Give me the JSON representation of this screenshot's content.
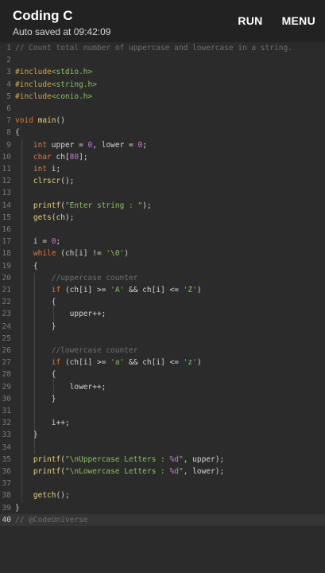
{
  "app": {
    "title": "Coding C",
    "autosave_text": "Auto saved at 09:42:09",
    "run_label": "RUN",
    "menu_label": "MENU"
  },
  "editor": {
    "active_line": 40,
    "lines": [
      {
        "n": "1",
        "tokens": [
          {
            "t": "c",
            "v": "// Count total number of uppercase and lowercase in a string."
          }
        ]
      },
      {
        "n": "2",
        "tokens": []
      },
      {
        "n": "3",
        "tokens": [
          {
            "t": "p",
            "v": "#include"
          },
          {
            "t": "h",
            "v": "<stdio.h>"
          }
        ]
      },
      {
        "n": "4",
        "tokens": [
          {
            "t": "p",
            "v": "#include"
          },
          {
            "t": "h",
            "v": "<string.h>"
          }
        ]
      },
      {
        "n": "5",
        "tokens": [
          {
            "t": "p",
            "v": "#include"
          },
          {
            "t": "h",
            "v": "<conio.h>"
          }
        ]
      },
      {
        "n": "6",
        "tokens": []
      },
      {
        "n": "7",
        "tokens": [
          {
            "t": "k",
            "v": "void"
          },
          {
            "t": "d",
            "v": " "
          },
          {
            "t": "f",
            "v": "main"
          },
          {
            "t": "d",
            "v": "()"
          }
        ]
      },
      {
        "n": "8",
        "tokens": [
          {
            "t": "d",
            "v": "{"
          }
        ]
      },
      {
        "n": "9",
        "tokens": [
          {
            "t": "d",
            "v": "    "
          },
          {
            "t": "k",
            "v": "int"
          },
          {
            "t": "d",
            "v": " upper = "
          },
          {
            "t": "n",
            "v": "0"
          },
          {
            "t": "d",
            "v": ", lower = "
          },
          {
            "t": "n",
            "v": "0"
          },
          {
            "t": "d",
            "v": ";"
          }
        ]
      },
      {
        "n": "10",
        "tokens": [
          {
            "t": "d",
            "v": "    "
          },
          {
            "t": "k",
            "v": "char"
          },
          {
            "t": "d",
            "v": " ch["
          },
          {
            "t": "n",
            "v": "80"
          },
          {
            "t": "d",
            "v": "];"
          }
        ]
      },
      {
        "n": "11",
        "tokens": [
          {
            "t": "d",
            "v": "    "
          },
          {
            "t": "k",
            "v": "int"
          },
          {
            "t": "d",
            "v": " i;"
          }
        ]
      },
      {
        "n": "12",
        "tokens": [
          {
            "t": "d",
            "v": "    "
          },
          {
            "t": "f",
            "v": "clrscr"
          },
          {
            "t": "d",
            "v": "();"
          }
        ]
      },
      {
        "n": "13",
        "tokens": []
      },
      {
        "n": "14",
        "tokens": [
          {
            "t": "d",
            "v": "    "
          },
          {
            "t": "f",
            "v": "printf"
          },
          {
            "t": "d",
            "v": "("
          },
          {
            "t": "s",
            "v": "\"Enter string : \""
          },
          {
            "t": "d",
            "v": ");"
          }
        ]
      },
      {
        "n": "15",
        "tokens": [
          {
            "t": "d",
            "v": "    "
          },
          {
            "t": "f",
            "v": "gets"
          },
          {
            "t": "d",
            "v": "(ch);"
          }
        ]
      },
      {
        "n": "16",
        "tokens": []
      },
      {
        "n": "17",
        "tokens": [
          {
            "t": "d",
            "v": "    i = "
          },
          {
            "t": "n",
            "v": "0"
          },
          {
            "t": "d",
            "v": ";"
          }
        ]
      },
      {
        "n": "18",
        "tokens": [
          {
            "t": "d",
            "v": "    "
          },
          {
            "t": "k",
            "v": "while"
          },
          {
            "t": "d",
            "v": " (ch[i] != "
          },
          {
            "t": "s",
            "v": "'\\0'"
          },
          {
            "t": "d",
            "v": ")"
          }
        ]
      },
      {
        "n": "19",
        "tokens": [
          {
            "t": "d",
            "v": "    {"
          }
        ]
      },
      {
        "n": "20",
        "tokens": [
          {
            "t": "d",
            "v": "        "
          },
          {
            "t": "c",
            "v": "//uppercase counter"
          }
        ]
      },
      {
        "n": "21",
        "tokens": [
          {
            "t": "d",
            "v": "        "
          },
          {
            "t": "k",
            "v": "if"
          },
          {
            "t": "d",
            "v": " (ch[i] >= "
          },
          {
            "t": "s",
            "v": "'A'"
          },
          {
            "t": "d",
            "v": " && ch[i] <= "
          },
          {
            "t": "s",
            "v": "'Z'"
          },
          {
            "t": "d",
            "v": ")"
          }
        ]
      },
      {
        "n": "22",
        "tokens": [
          {
            "t": "d",
            "v": "        {"
          }
        ]
      },
      {
        "n": "23",
        "tokens": [
          {
            "t": "d",
            "v": "            upper++;"
          }
        ]
      },
      {
        "n": "24",
        "tokens": [
          {
            "t": "d",
            "v": "        }"
          }
        ]
      },
      {
        "n": "25",
        "tokens": []
      },
      {
        "n": "26",
        "tokens": [
          {
            "t": "d",
            "v": "        "
          },
          {
            "t": "c",
            "v": "//lowercase counter"
          }
        ]
      },
      {
        "n": "27",
        "tokens": [
          {
            "t": "d",
            "v": "        "
          },
          {
            "t": "k",
            "v": "if"
          },
          {
            "t": "d",
            "v": " (ch[i] >= "
          },
          {
            "t": "s",
            "v": "'a'"
          },
          {
            "t": "d",
            "v": " && ch[i] <= "
          },
          {
            "t": "s",
            "v": "'z'"
          },
          {
            "t": "d",
            "v": ")"
          }
        ]
      },
      {
        "n": "28",
        "tokens": [
          {
            "t": "d",
            "v": "        {"
          }
        ]
      },
      {
        "n": "29",
        "tokens": [
          {
            "t": "d",
            "v": "            lower++;"
          }
        ]
      },
      {
        "n": "30",
        "tokens": [
          {
            "t": "d",
            "v": "        }"
          }
        ]
      },
      {
        "n": "31",
        "tokens": []
      },
      {
        "n": "32",
        "tokens": [
          {
            "t": "d",
            "v": "        i++;"
          }
        ]
      },
      {
        "n": "33",
        "tokens": [
          {
            "t": "d",
            "v": "    }"
          }
        ]
      },
      {
        "n": "34",
        "tokens": []
      },
      {
        "n": "35",
        "tokens": [
          {
            "t": "d",
            "v": "    "
          },
          {
            "t": "f",
            "v": "printf"
          },
          {
            "t": "d",
            "v": "("
          },
          {
            "t": "s",
            "v": "\"\\nUppercase Letters : "
          },
          {
            "t": "e",
            "v": "%d"
          },
          {
            "t": "s",
            "v": "\""
          },
          {
            "t": "d",
            "v": ", upper);"
          }
        ]
      },
      {
        "n": "36",
        "tokens": [
          {
            "t": "d",
            "v": "    "
          },
          {
            "t": "f",
            "v": "printf"
          },
          {
            "t": "d",
            "v": "("
          },
          {
            "t": "s",
            "v": "\"\\nLowercase Letters : "
          },
          {
            "t": "e",
            "v": "%d"
          },
          {
            "t": "s",
            "v": "\""
          },
          {
            "t": "d",
            "v": ", lower);"
          }
        ]
      },
      {
        "n": "37",
        "tokens": []
      },
      {
        "n": "38",
        "tokens": [
          {
            "t": "d",
            "v": "    "
          },
          {
            "t": "f",
            "v": "getch"
          },
          {
            "t": "d",
            "v": "();"
          }
        ]
      },
      {
        "n": "39",
        "tokens": [
          {
            "t": "d",
            "v": "}"
          }
        ]
      },
      {
        "n": "40",
        "tokens": [
          {
            "t": "c",
            "v": "// @CodeUniverse"
          }
        ]
      }
    ]
  },
  "colors": {
    "background": "#2b2b2b",
    "comment": "#6f6f6f",
    "keyword": "#e07a3a",
    "string": "#8fbf63",
    "function": "#e7d17c",
    "number": "#c678dd"
  }
}
